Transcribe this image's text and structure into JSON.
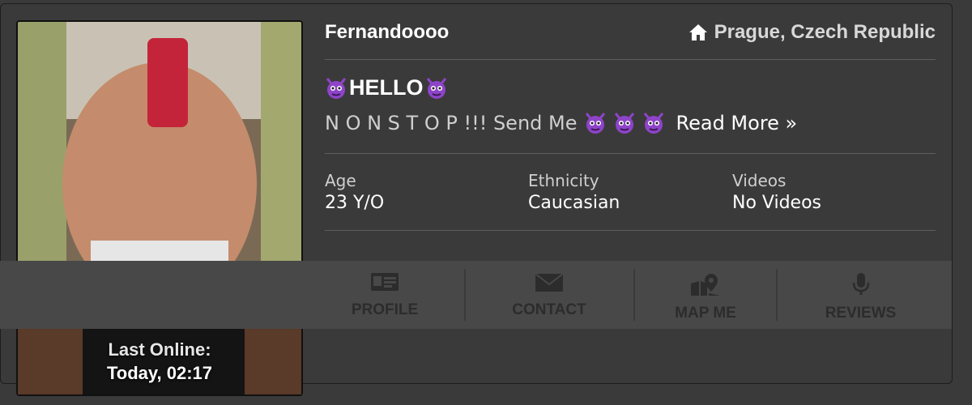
{
  "profile": {
    "name": "Fernandoooo",
    "location": "Prague, Czech Republic",
    "headline": "HELLO",
    "teaser": "N O N S T O P !!! Send Me",
    "read_more": "Read More »",
    "last_online_label": "Last Online:",
    "last_online_value": "Today, 02:17"
  },
  "stats": [
    {
      "label": "Age",
      "value": "23 Y/O"
    },
    {
      "label": "Ethnicity",
      "value": "Caucasian"
    },
    {
      "label": "Videos",
      "value": "No Videos"
    }
  ],
  "actions": [
    {
      "label": "PROFILE",
      "icon": "id-card-icon"
    },
    {
      "label": "CONTACT",
      "icon": "envelope-icon"
    },
    {
      "label": "MAP ME",
      "icon": "map-pin-icon"
    },
    {
      "label": "REVIEWS",
      "icon": "microphone-icon"
    }
  ],
  "colors": {
    "background": "#3a3a3a",
    "action_bar": "#484848",
    "action_text": "#2c2c2c",
    "emoji_purple": "#8e44c9"
  }
}
